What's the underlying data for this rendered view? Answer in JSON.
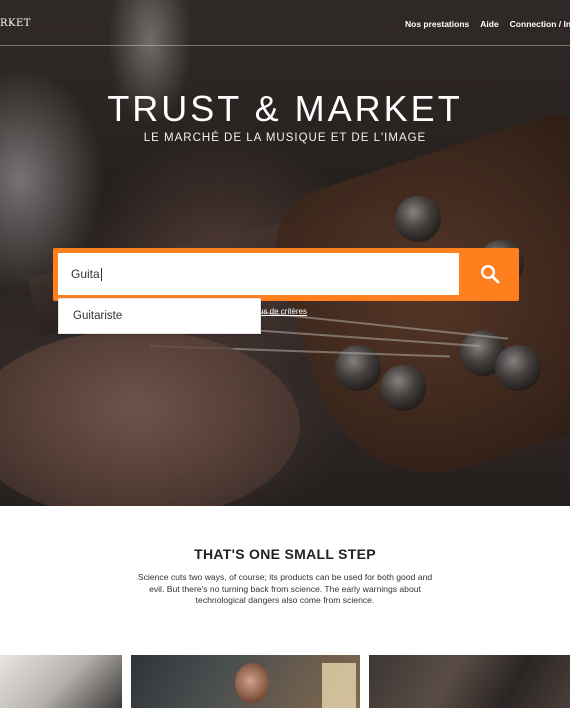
{
  "nav": {
    "logo": "RKET",
    "links": [
      "Nos prestations",
      "Aide",
      "Connection / Ins"
    ]
  },
  "hero": {
    "title": "TRUST & MARKET",
    "subtitle": "LE MARCHÉ DE LA MUSIQUE ET DE L'IMAGE"
  },
  "search": {
    "value": "Guita",
    "criteria_link": "us de critères",
    "suggestions": [
      "Guitariste"
    ],
    "accent_color": "#ff7f1f"
  },
  "section": {
    "title": "THAT'S ONE SMALL STEP",
    "text": "Science cuts two ways, of course; its products can be used for both good and evil. But there's no turning back from science. The early warnings about technological dangers also come from science."
  }
}
